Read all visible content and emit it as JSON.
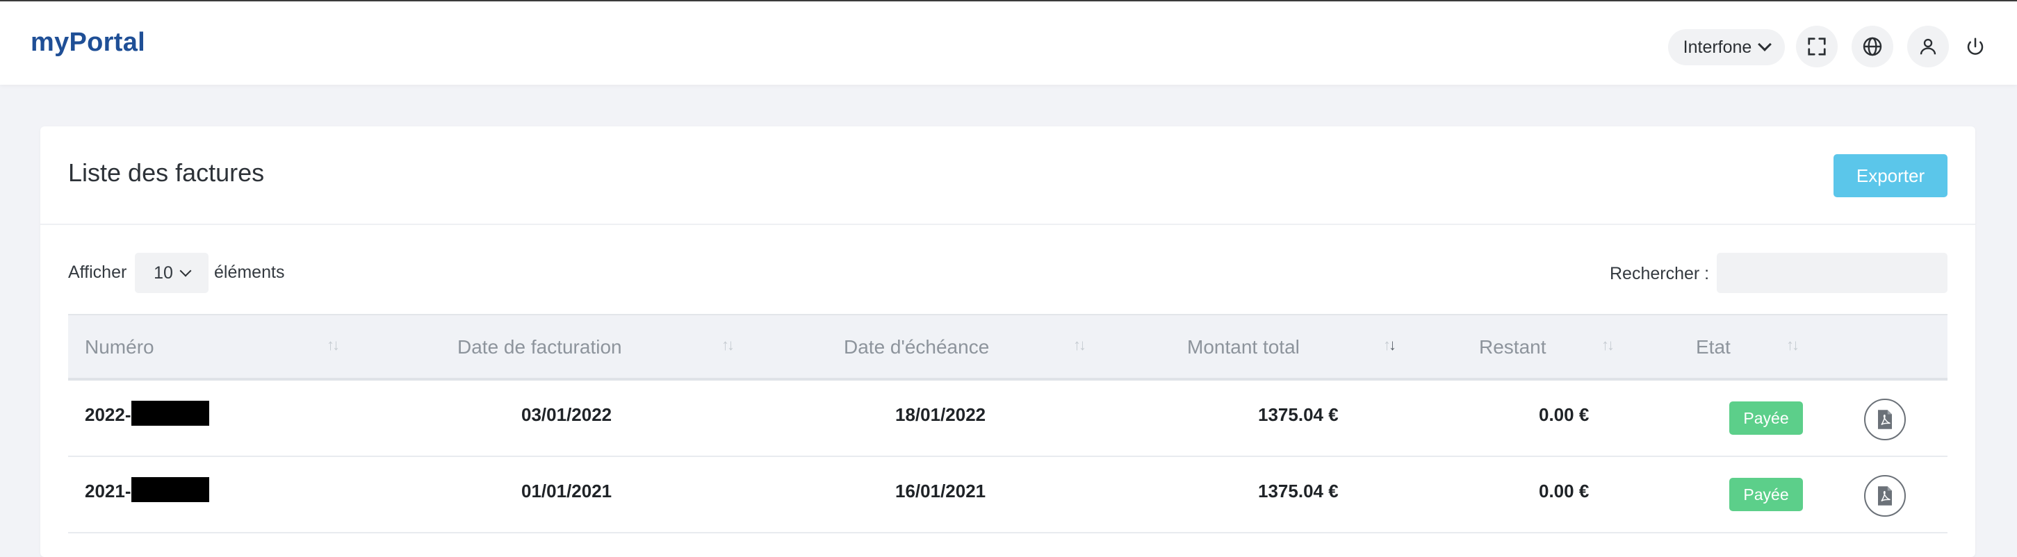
{
  "header": {
    "brand": "myPortal",
    "company_select": "Interfone",
    "icons": [
      "fullscreen-icon",
      "globe-icon",
      "user-icon",
      "power-icon"
    ]
  },
  "page": {
    "title": "Liste des factures",
    "export_label": "Exporter"
  },
  "controls": {
    "show_prefix": "Afficher",
    "page_length": "10",
    "show_suffix": "éléments",
    "search_label": "Rechercher :",
    "search_value": ""
  },
  "table": {
    "columns": [
      "Numéro",
      "Date de facturation",
      "Date d'échéance",
      "Montant total",
      "Restant",
      "Etat"
    ],
    "sorted_column": "Montant total",
    "sort_direction": "descending",
    "rows": [
      {
        "numero": "2022-",
        "date_facturation": "03/01/2022",
        "date_echeance": "18/01/2022",
        "montant": "1375.04 €",
        "restant": "0.00 €",
        "etat": "Payée"
      },
      {
        "numero": "2021-",
        "date_facturation": "01/01/2021",
        "date_echeance": "16/01/2021",
        "montant": "1375.04 €",
        "restant": "0.00 €",
        "etat": "Payée"
      }
    ]
  },
  "colors": {
    "brand": "#1f4f96",
    "export_button": "#5bc6ea",
    "paid_badge": "#5ccf8a"
  }
}
